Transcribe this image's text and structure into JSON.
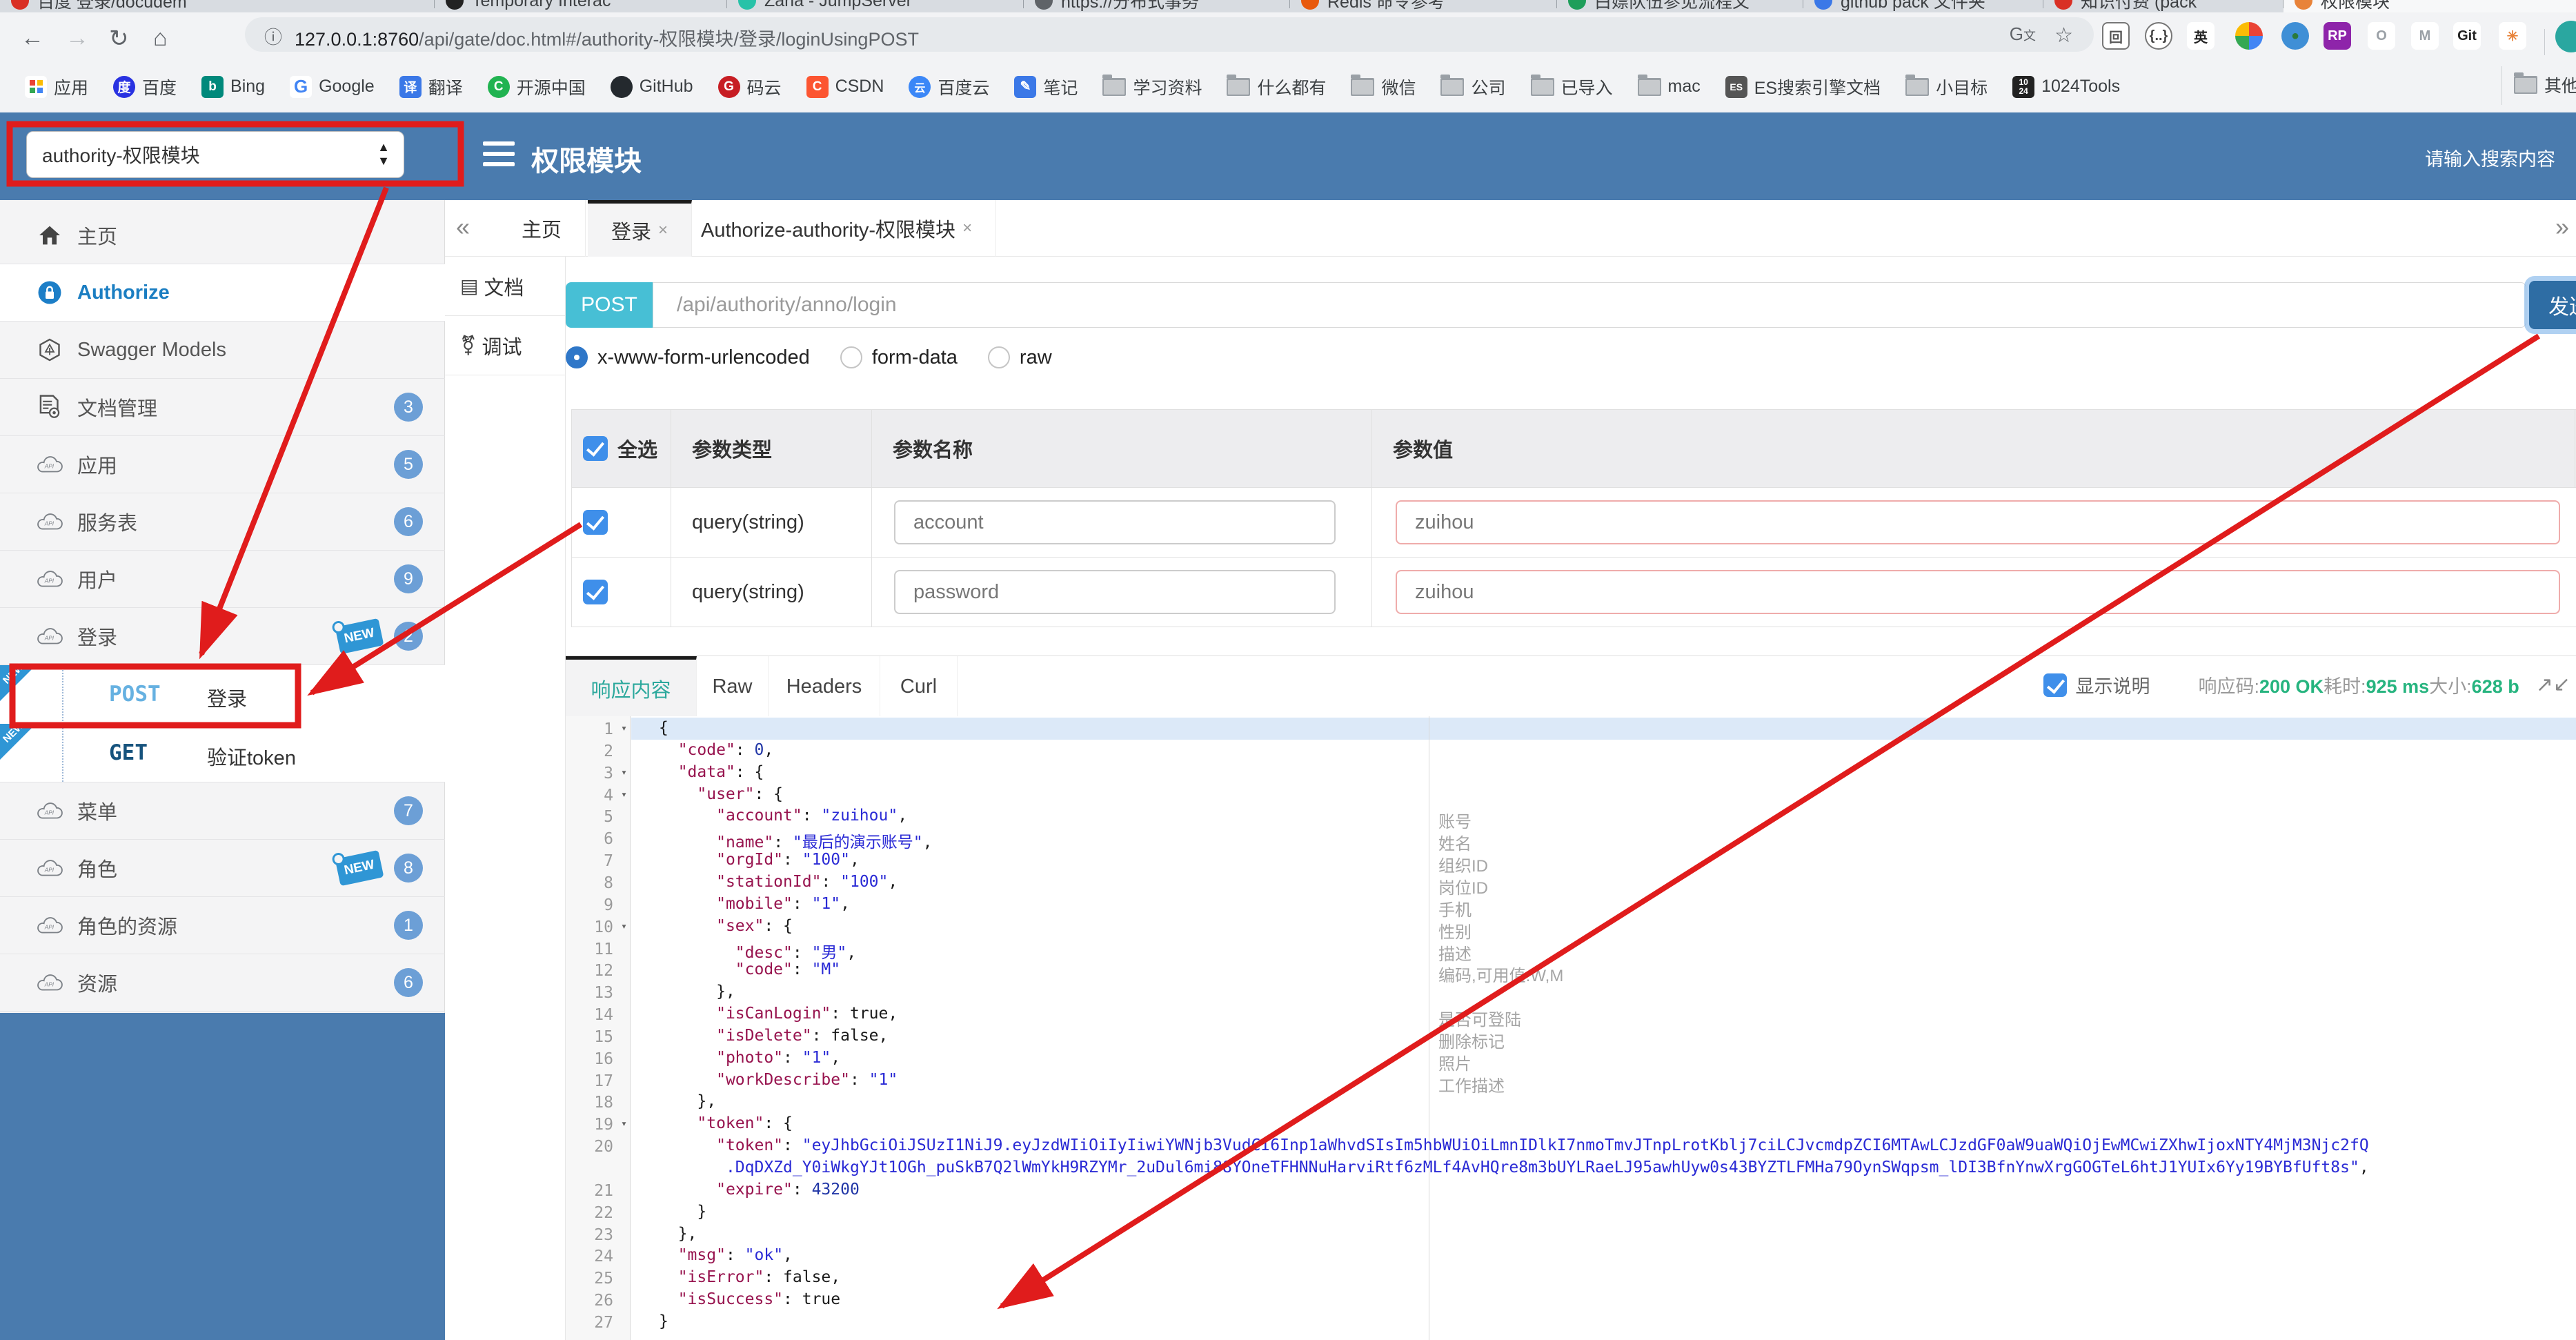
{
  "browser": {
    "tabs": [
      {
        "title": "百度 登录/docudem",
        "color": "#d93025"
      },
      {
        "title": "Temporary Interac",
        "color": "#222222"
      },
      {
        "title": "Zana - JumpServer",
        "color": "#27c2a8"
      },
      {
        "title": "https://分布式事务",
        "color": "#5f6368"
      },
      {
        "title": "Redis 命令参考",
        "color": "#e8590c"
      },
      {
        "title": "白嫖队伍参见流程文",
        "color": "#1e9e5a"
      },
      {
        "title": "github pack 文件夹",
        "color": "#3b78e7"
      },
      {
        "title": "知识付费 (pack",
        "color": "#d93025"
      },
      {
        "title": "权限模块",
        "color": "#e8833a"
      }
    ],
    "url_host": "127.0.0.1:8760",
    "url_path": "/api/gate/doc.html#/authority-权限模块/登录/loginUsingPOST",
    "bookmarks": [
      {
        "label": "应用",
        "icon": "apps"
      },
      {
        "label": "百度",
        "icon": "baidu"
      },
      {
        "label": "Bing",
        "icon": "bing"
      },
      {
        "label": "Google",
        "icon": "google"
      },
      {
        "label": "翻译",
        "icon": "translate"
      },
      {
        "label": "开源中国",
        "icon": "osc"
      },
      {
        "label": "GitHub",
        "icon": "github"
      },
      {
        "label": "码云",
        "icon": "gitee"
      },
      {
        "label": "CSDN",
        "icon": "csdn"
      },
      {
        "label": "百度云",
        "icon": "baiduyun"
      },
      {
        "label": "笔记",
        "icon": "note"
      },
      {
        "label": "学习资料",
        "icon": "folder"
      },
      {
        "label": "什么都有",
        "icon": "folder"
      },
      {
        "label": "微信",
        "icon": "folder"
      },
      {
        "label": "公司",
        "icon": "folder"
      },
      {
        "label": "已导入",
        "icon": "folder"
      },
      {
        "label": "mac",
        "icon": "folder"
      },
      {
        "label": "ES搜索引擎文档",
        "icon": "book"
      },
      {
        "label": "小目标",
        "icon": "folder"
      },
      {
        "label": "1024Tools",
        "icon": "t1024"
      }
    ],
    "bookmarks_overflow": "其他书签"
  },
  "header": {
    "module_select": "authority-权限模块",
    "title": "权限模块",
    "search_placeholder": "请输入搜索内容"
  },
  "sidebar": {
    "items": [
      {
        "icon": "home",
        "label": "主页"
      },
      {
        "icon": "lock",
        "label": "Authorize",
        "active": true
      },
      {
        "icon": "hexagon",
        "label": "Swagger Models"
      },
      {
        "icon": "docgear",
        "label": "文档管理",
        "badge": "3"
      },
      {
        "icon": "cloud",
        "label": "应用",
        "badge": "5"
      },
      {
        "icon": "cloud",
        "label": "服务表",
        "badge": "6"
      },
      {
        "icon": "cloud",
        "label": "用户",
        "badge": "9"
      },
      {
        "icon": "cloud",
        "label": "登录",
        "badge": "2",
        "new": true
      }
    ],
    "sub_items": [
      {
        "method": "POST",
        "label": "登录",
        "corner_new": true
      },
      {
        "method": "GET",
        "label": "验证token",
        "corner_new": true
      }
    ],
    "items_after": [
      {
        "icon": "cloud",
        "label": "菜单",
        "badge": "7"
      },
      {
        "icon": "cloud",
        "label": "角色",
        "badge": "8",
        "new": true
      },
      {
        "icon": "cloud",
        "label": "角色的资源",
        "badge": "1"
      },
      {
        "icon": "cloud",
        "label": "资源",
        "badge": "6"
      }
    ]
  },
  "content_tabs": {
    "collapse": "«",
    "expand": "»",
    "tabs": [
      {
        "label": "主页",
        "closable": false
      },
      {
        "label": "登录",
        "closable": true,
        "active": true
      },
      {
        "label": "Authorize-authority-权限模块",
        "closable": true
      }
    ]
  },
  "doc_nav": [
    {
      "label": "文档",
      "icon": "doc"
    },
    {
      "label": "调试",
      "icon": "bug"
    }
  ],
  "request": {
    "method": "POST",
    "url": "/api/authority/anno/login",
    "send_label": "发送",
    "body_types": [
      {
        "label": "x-www-form-urlencoded",
        "checked": true
      },
      {
        "label": "form-data",
        "checked": false
      },
      {
        "label": "raw",
        "checked": false
      }
    ]
  },
  "params": {
    "headers": [
      "全选",
      "参数类型",
      "参数名称",
      "参数值"
    ],
    "rows": [
      {
        "checked": true,
        "type": "query(string)",
        "name": "account",
        "value": "zuihou"
      },
      {
        "checked": true,
        "type": "query(string)",
        "name": "password",
        "value": "zuihou"
      }
    ]
  },
  "response": {
    "tabs": [
      "响应内容",
      "Raw",
      "Headers",
      "Curl"
    ],
    "active_tab": "响应内容",
    "show_desc_label": "显示说明",
    "meta": [
      {
        "label": "响应码:",
        "value": "200 OK"
      },
      {
        "label": "耗时:",
        "value": "925 ms"
      },
      {
        "label": "大小:",
        "value": "628 b"
      }
    ]
  },
  "code": {
    "lines": [
      {
        "n": 1,
        "fold": true,
        "seg": [
          [
            "p",
            "{"
          ]
        ]
      },
      {
        "n": 2,
        "seg": [
          [
            "p",
            "  "
          ],
          [
            "k",
            "\"code\""
          ],
          [
            "p",
            ": "
          ],
          [
            "n",
            "0"
          ],
          [
            "p",
            ","
          ]
        ]
      },
      {
        "n": 3,
        "fold": true,
        "seg": [
          [
            "p",
            "  "
          ],
          [
            "k",
            "\"data\""
          ],
          [
            "p",
            ": {"
          ]
        ]
      },
      {
        "n": 4,
        "fold": true,
        "seg": [
          [
            "p",
            "    "
          ],
          [
            "k",
            "\"user\""
          ],
          [
            "p",
            ": {"
          ]
        ]
      },
      {
        "n": 5,
        "seg": [
          [
            "p",
            "      "
          ],
          [
            "k",
            "\"account\""
          ],
          [
            "p",
            ": "
          ],
          [
            "s",
            "\"zuihou\""
          ],
          [
            "p",
            ","
          ]
        ]
      },
      {
        "n": 6,
        "seg": [
          [
            "p",
            "      "
          ],
          [
            "k",
            "\"name\""
          ],
          [
            "p",
            ": "
          ],
          [
            "s",
            "\"最后的演示账号\""
          ],
          [
            "p",
            ","
          ]
        ]
      },
      {
        "n": 7,
        "seg": [
          [
            "p",
            "      "
          ],
          [
            "k",
            "\"orgId\""
          ],
          [
            "p",
            ": "
          ],
          [
            "s",
            "\"100\""
          ],
          [
            "p",
            ","
          ]
        ]
      },
      {
        "n": 8,
        "seg": [
          [
            "p",
            "      "
          ],
          [
            "k",
            "\"stationId\""
          ],
          [
            "p",
            ": "
          ],
          [
            "s",
            "\"100\""
          ],
          [
            "p",
            ","
          ]
        ]
      },
      {
        "n": 9,
        "seg": [
          [
            "p",
            "      "
          ],
          [
            "k",
            "\"mobile\""
          ],
          [
            "p",
            ": "
          ],
          [
            "s",
            "\"1\""
          ],
          [
            "p",
            ","
          ]
        ]
      },
      {
        "n": 10,
        "fold": true,
        "seg": [
          [
            "p",
            "      "
          ],
          [
            "k",
            "\"sex\""
          ],
          [
            "p",
            ": {"
          ]
        ]
      },
      {
        "n": 11,
        "seg": [
          [
            "p",
            "        "
          ],
          [
            "k",
            "\"desc\""
          ],
          [
            "p",
            ": "
          ],
          [
            "s",
            "\"男\""
          ],
          [
            "p",
            ","
          ]
        ]
      },
      {
        "n": 12,
        "seg": [
          [
            "p",
            "        "
          ],
          [
            "k",
            "\"code\""
          ],
          [
            "p",
            ": "
          ],
          [
            "s",
            "\"M\""
          ]
        ]
      },
      {
        "n": 13,
        "seg": [
          [
            "p",
            "      },"
          ]
        ]
      },
      {
        "n": 14,
        "seg": [
          [
            "p",
            "      "
          ],
          [
            "k",
            "\"isCanLogin\""
          ],
          [
            "p",
            ": "
          ],
          [
            "b",
            "true"
          ],
          [
            "p",
            ","
          ]
        ]
      },
      {
        "n": 15,
        "seg": [
          [
            "p",
            "      "
          ],
          [
            "k",
            "\"isDelete\""
          ],
          [
            "p",
            ": "
          ],
          [
            "b",
            "false"
          ],
          [
            "p",
            ","
          ]
        ]
      },
      {
        "n": 16,
        "seg": [
          [
            "p",
            "      "
          ],
          [
            "k",
            "\"photo\""
          ],
          [
            "p",
            ": "
          ],
          [
            "s",
            "\"1\""
          ],
          [
            "p",
            ","
          ]
        ]
      },
      {
        "n": 17,
        "seg": [
          [
            "p",
            "      "
          ],
          [
            "k",
            "\"workDescribe\""
          ],
          [
            "p",
            ": "
          ],
          [
            "s",
            "\"1\""
          ]
        ]
      },
      {
        "n": 18,
        "seg": [
          [
            "p",
            "    },"
          ]
        ]
      },
      {
        "n": 19,
        "fold": true,
        "seg": [
          [
            "p",
            "    "
          ],
          [
            "k",
            "\"token\""
          ],
          [
            "p",
            ": {"
          ]
        ]
      },
      {
        "n": 20,
        "seg": [
          [
            "p",
            "      "
          ],
          [
            "k",
            "\"token\""
          ],
          [
            "p",
            ": "
          ],
          [
            "s",
            "\"eyJhbGciOiJSUzI1NiJ9.eyJzdWIiOiIyIiwiYWNjb3VudCI6Inp1aWhvdSIsIm5hbWUiOiLmnIDlkI7nmoTmvJTnpLrotKblj7ciLCJvcmdpZCI6MTAwLCJzdGF0aW9uaWQiOjEwMCwiZXhwIjoxNTY4MjM3Njc2fQ"
          ]
        ]
      },
      {
        "n": null,
        "seg": [
          [
            "p",
            "       "
          ],
          [
            "s",
            ".DqDXZd_Y0iWkgYJt1OGh_puSkB7Q2lWmYkH9RZYMr_2uDul6mi88YOneTFHNNuHarviRtf6zMLf4AvHQre8m3bUYLRaeLJ95awhUyw0s43BYZTLFMHa79OynSWqpsm_lDI3BfnYnwXrgGOGTeL6htJ1YUIx6Yy19BYBfUft8s\""
          ],
          [
            "p",
            ","
          ]
        ]
      },
      {
        "n": 21,
        "seg": [
          [
            "p",
            "      "
          ],
          [
            "k",
            "\"expire\""
          ],
          [
            "p",
            ": "
          ],
          [
            "n",
            "43200"
          ]
        ]
      },
      {
        "n": 22,
        "seg": [
          [
            "p",
            "    }"
          ]
        ]
      },
      {
        "n": 23,
        "seg": [
          [
            "p",
            "  },"
          ]
        ]
      },
      {
        "n": 24,
        "seg": [
          [
            "p",
            "  "
          ],
          [
            "k",
            "\"msg\""
          ],
          [
            "p",
            ": "
          ],
          [
            "s",
            "\"ok\""
          ],
          [
            "p",
            ","
          ]
        ]
      },
      {
        "n": 25,
        "seg": [
          [
            "p",
            "  "
          ],
          [
            "k",
            "\"isError\""
          ],
          [
            "p",
            ": "
          ],
          [
            "b",
            "false"
          ],
          [
            "p",
            ","
          ]
        ]
      },
      {
        "n": 26,
        "seg": [
          [
            "p",
            "  "
          ],
          [
            "k",
            "\"isSuccess\""
          ],
          [
            "p",
            ": "
          ],
          [
            "b",
            "true"
          ]
        ]
      },
      {
        "n": 27,
        "seg": [
          [
            "p",
            "}"
          ]
        ]
      }
    ],
    "descriptions": [
      {
        "vline": 5,
        "text": "账号"
      },
      {
        "vline": 6,
        "text": "姓名"
      },
      {
        "vline": 7,
        "text": "组织ID"
      },
      {
        "vline": 8,
        "text": "岗位ID"
      },
      {
        "vline": 9,
        "text": "手机"
      },
      {
        "vline": 10,
        "text": "性别"
      },
      {
        "vline": 11,
        "text": "描述"
      },
      {
        "vline": 12,
        "text": "编码,可用值:W,M"
      },
      {
        "vline": 14,
        "text": "是否可登陆"
      },
      {
        "vline": 15,
        "text": "删除标记"
      },
      {
        "vline": 16,
        "text": "照片"
      },
      {
        "vline": 17,
        "text": "工作描述"
      }
    ]
  }
}
